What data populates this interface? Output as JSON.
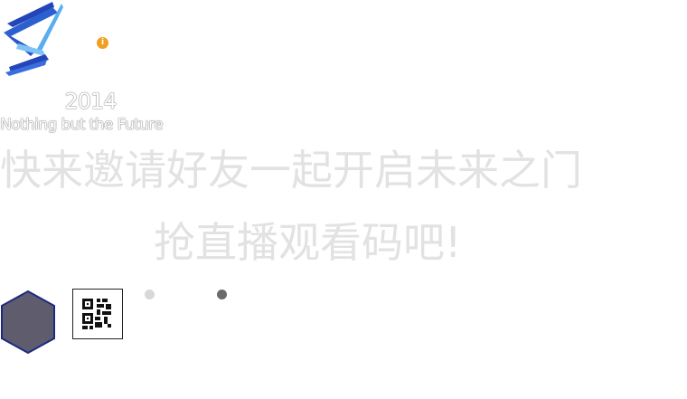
{
  "brand": {
    "logo_icon": "blue-zigzag-s-logo-icon",
    "year": "2014",
    "slogan": "Nothing but the Future"
  },
  "info_icon": {
    "name": "info-icon",
    "glyph": "i",
    "color": "#f0a020"
  },
  "promo": {
    "headline": "快来邀请好友一起开启未来之门",
    "subline": "抢直播观看码吧!"
  },
  "controls": {
    "hexagon_color": "#5f5c6e",
    "hexagon_border": "#1e2a80",
    "qr_icon": "qr-code-icon",
    "pagination": [
      {
        "state": "inactive",
        "color": "#d8d8d8"
      },
      {
        "state": "active",
        "color": "#6a6a6a"
      }
    ]
  }
}
